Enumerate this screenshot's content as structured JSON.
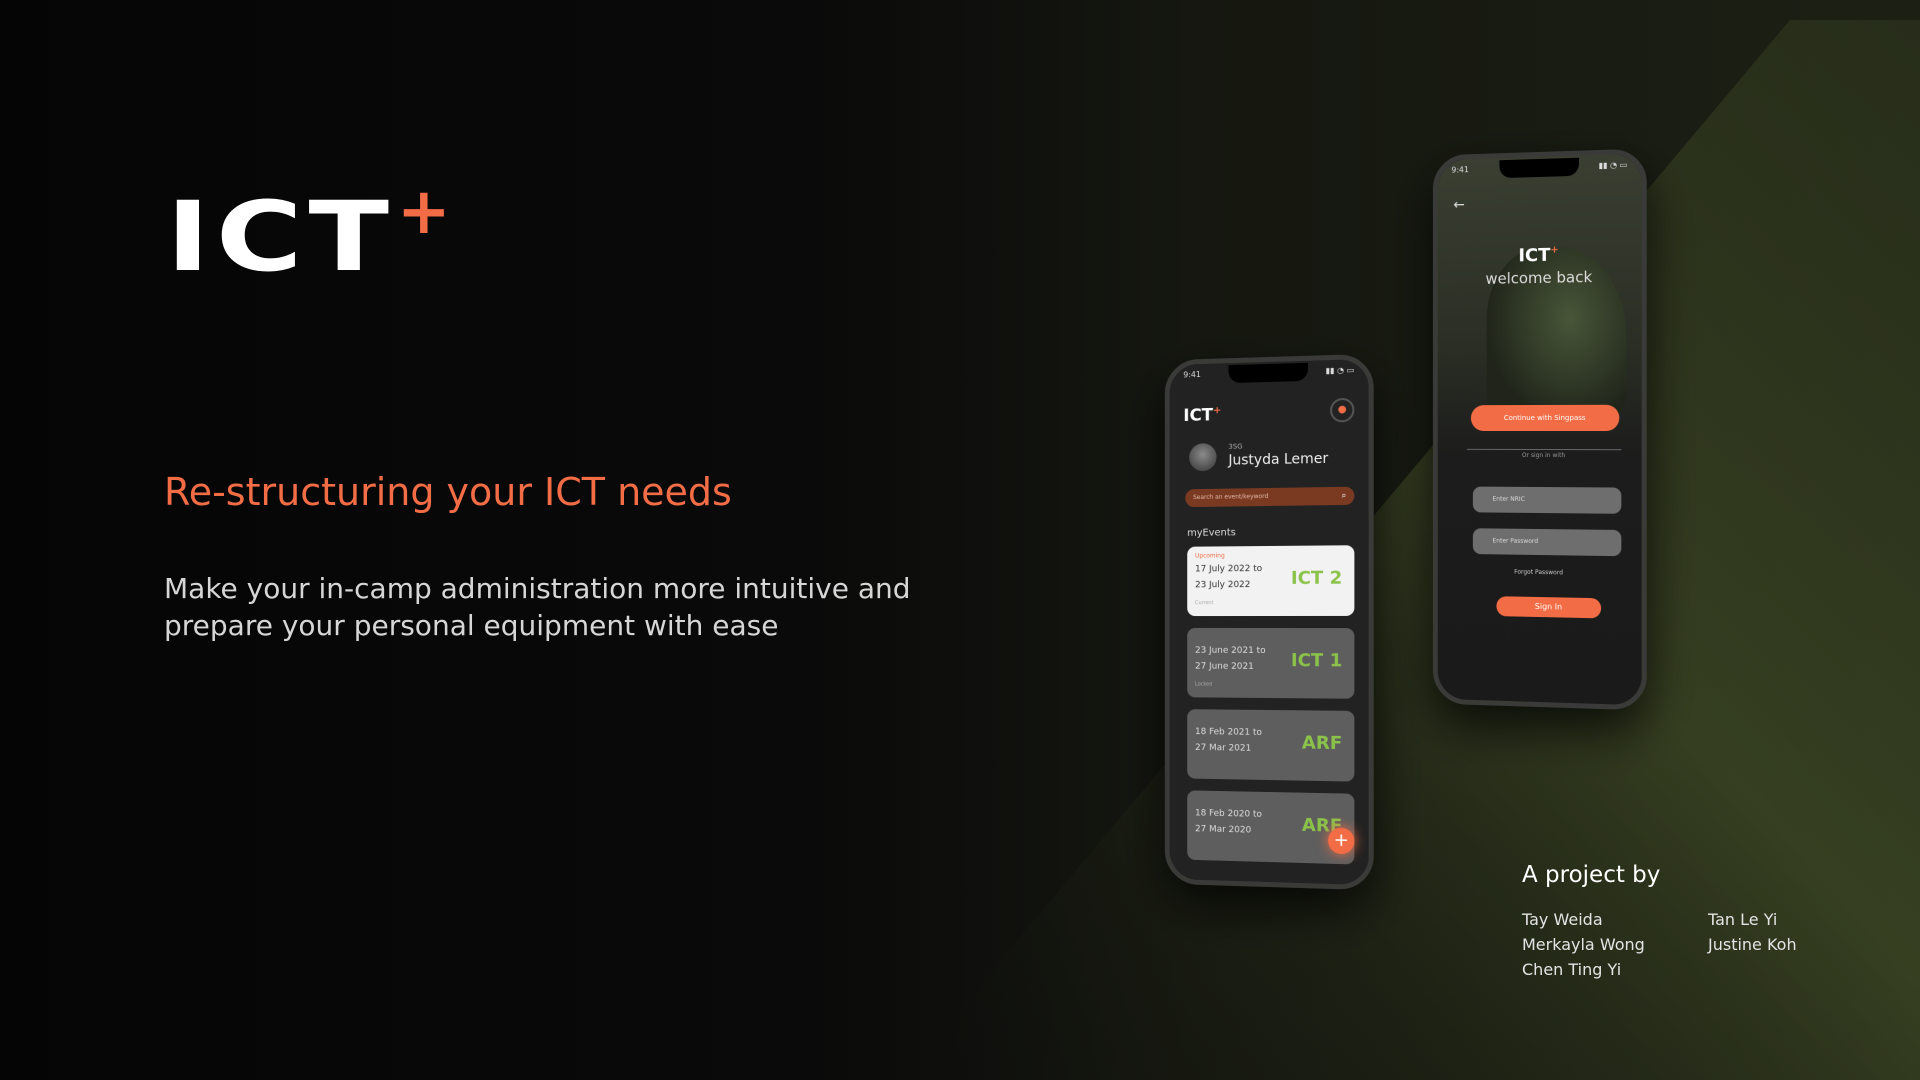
{
  "brand": {
    "name": "ICT",
    "plus": "+",
    "accent": "#f26c45"
  },
  "headline": "Re-structuring your ICT needs",
  "subtext": "Make your in-camp administration more intuitive and prepare your personal equipment with ease",
  "credits": {
    "title": "A project by",
    "names": [
      "Tay Weida",
      "Tan Le Yi",
      "Merkayla Wong",
      "Justine Koh",
      "Chen Ting Yi"
    ]
  },
  "phone_home": {
    "time": "9:41",
    "logo": "ICT",
    "logo_plus": "+",
    "rank": "3SG",
    "user_name": "Justyda Lemer",
    "search_placeholder": "Search an event/keyword",
    "section": "myEvents",
    "events": [
      {
        "tag": "Upcoming",
        "from": "17 July 2022 to",
        "to": "23 July 2022",
        "code": "ICT 2",
        "status": "Current"
      },
      {
        "tag": "",
        "from": "23 June 2021 to",
        "to": "27 June 2021",
        "code": "ICT 1",
        "status": "Locked"
      },
      {
        "tag": "",
        "from": "18 Feb 2021 to",
        "to": "27 Mar 2021",
        "code": "ARF",
        "status": ""
      },
      {
        "tag": "",
        "from": "18 Feb 2020 to",
        "to": "27 Mar 2020",
        "code": "ARF",
        "status": ""
      }
    ],
    "fab": "+"
  },
  "phone_login": {
    "time": "9:41",
    "logo": "ICT",
    "logo_plus": "+",
    "welcome": "welcome back",
    "continue_button": "Continue with Singpass",
    "divider": "Or sign in with",
    "field_user": "Enter NRIC",
    "field_pass": "Enter Password",
    "forgot": "Forgot Password",
    "sign_in": "Sign In"
  }
}
